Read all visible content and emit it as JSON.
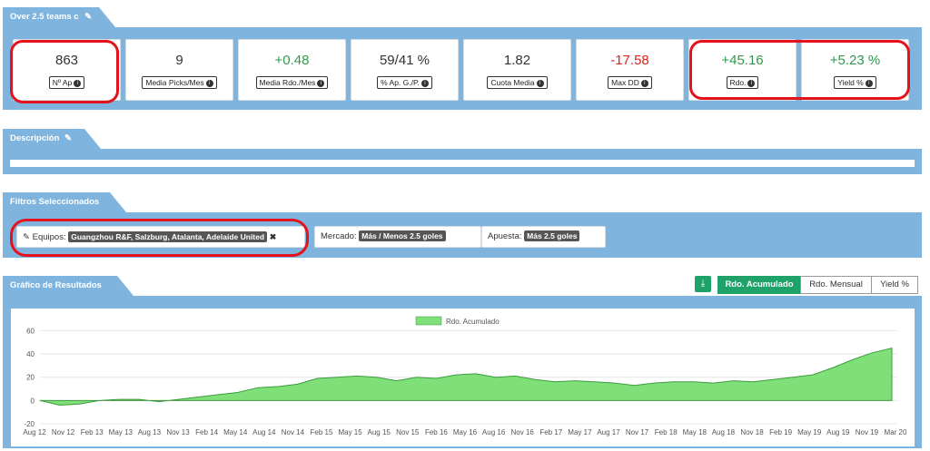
{
  "strategy": {
    "title": "Over 2.5 teams c"
  },
  "stats": [
    {
      "value": "863",
      "label": "Nº Ap",
      "tone": "neutral"
    },
    {
      "value": "9",
      "label": "Media Picks/Mes",
      "tone": "neutral"
    },
    {
      "value": "+0.48",
      "label": "Media Rdo./Mes",
      "tone": "pos"
    },
    {
      "value": "59/41 %",
      "label": "% Ap. G./P.",
      "tone": "neutral"
    },
    {
      "value": "1.82",
      "label": "Cuota Media",
      "tone": "neutral"
    },
    {
      "value": "-17.58",
      "label": "Max DD",
      "tone": "neg"
    },
    {
      "value": "+45.16",
      "label": "Rdo.",
      "tone": "pos"
    },
    {
      "value": "+5.23 %",
      "label": "Yield %",
      "tone": "pos"
    }
  ],
  "description": {
    "title": "Descripción"
  },
  "filters": {
    "title": "Filtros Seleccionados",
    "equipos_label": "Equipos:",
    "equipos_value": "Guangzhou R&F, Salzburg, Atalanta, Adelaide United",
    "mercado_label": "Mercado:",
    "mercado_value": "Más / Menos 2.5 goles",
    "apuesta_label": "Apuesta:",
    "apuesta_value": "Más 2.5 goles"
  },
  "results": {
    "title": "Gráfico de Resultados",
    "buttons": {
      "acumulado": "Rdo. Acumulado",
      "mensual": "Rdo. Mensual",
      "yield": "Yield %"
    },
    "active_button": "acumulado"
  },
  "colors": {
    "band": "#7fb4de",
    "positive": "#2e9a4a",
    "negative": "#e0201a",
    "area": "#7fe07a",
    "active": "#1fa26a",
    "highlight": "#e3121b"
  },
  "icons": {
    "edit": "pencil-icon",
    "info": "info-icon",
    "remove": "close-icon",
    "download": "download-icon"
  },
  "chart_data": {
    "type": "area",
    "legend": "Rdo. Acumulado",
    "x_ticks": [
      "Aug 12",
      "Nov 12",
      "Feb 13",
      "May 13",
      "Aug 13",
      "Nov 13",
      "Feb 14",
      "May 14",
      "Aug 14",
      "Nov 14",
      "Feb 15",
      "May 15",
      "Aug 15",
      "Nov 15",
      "Feb 16",
      "May 16",
      "Aug 16",
      "Nov 16",
      "Feb 17",
      "May 17",
      "Aug 17",
      "Nov 17",
      "Feb 18",
      "May 18",
      "Aug 18",
      "Nov 18",
      "Feb 19",
      "May 19",
      "Aug 19",
      "Nov 19",
      "Mar 20"
    ],
    "y_ticks": [
      -20,
      0,
      20,
      40,
      60
    ],
    "ylim": [
      -20,
      65
    ],
    "values": [
      0,
      -4,
      -3,
      0,
      1,
      1,
      -1,
      1,
      3,
      5,
      7,
      11,
      12,
      14,
      19,
      20,
      21,
      20,
      17,
      20,
      19,
      22,
      23,
      20,
      21,
      18,
      16,
      17,
      16,
      15,
      13,
      15,
      16,
      16,
      15,
      17,
      16,
      18,
      20,
      22,
      28,
      35,
      41,
      45
    ],
    "legend_position": "top-center",
    "grid": true
  }
}
